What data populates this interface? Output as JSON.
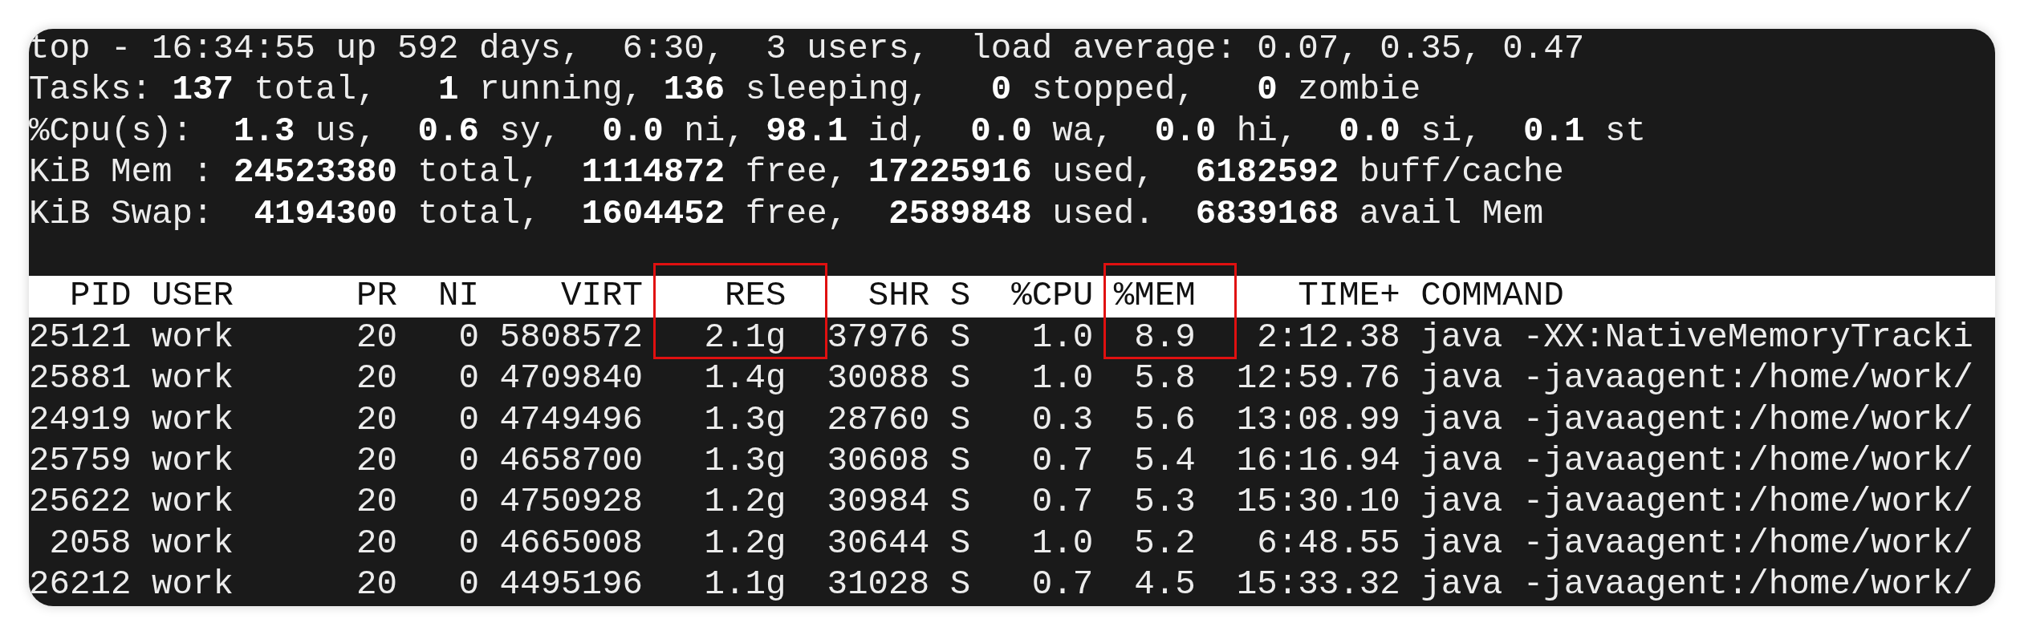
{
  "terminal": {
    "summary_lines": [
      "top - 16:34:55 up 592 days,  6:30,  3 users,  load average: 0.07, 0.35, 0.47",
      "Tasks: **137** total,   **1** running, **136** sleeping,   **0** stopped,   **0** zombie",
      "%Cpu(s):  **1.3** us,  **0.6** sy,  **0.0** ni, **98.1** id,  **0.0** wa,  **0.0** hi,  **0.0** si,  **0.1** st",
      "KiB Mem : **24523380** total,  **1114872** free, **17225916** used,  **6182592** buff/cache",
      "KiB Swap:  **4194300** total,  **1604452** free,  **2589848** used.  **6839168** avail Mem"
    ],
    "columns": [
      {
        "label": "PID",
        "boxed": false
      },
      {
        "label": "USER",
        "boxed": false
      },
      {
        "label": "PR",
        "boxed": false
      },
      {
        "label": "NI",
        "boxed": false
      },
      {
        "label": "VIRT",
        "boxed": false
      },
      {
        "label": "RES",
        "boxed": true
      },
      {
        "label": "SHR",
        "boxed": false
      },
      {
        "label": "S",
        "boxed": false
      },
      {
        "label": "%CPU",
        "boxed": false
      },
      {
        "label": "%MEM",
        "boxed": true
      },
      {
        "label": "TIME+",
        "boxed": false
      },
      {
        "label": "COMMAND",
        "boxed": false
      }
    ],
    "rows": [
      [
        "25121",
        "work",
        "20",
        "0",
        "5808572",
        "2.1g",
        "37976",
        "S",
        "1.0",
        "8.9",
        "2:12.38",
        "java -XX:NativeMemoryTracki"
      ],
      [
        "25881",
        "work",
        "20",
        "0",
        "4709840",
        "1.4g",
        "30088",
        "S",
        "1.0",
        "5.8",
        "12:59.76",
        "java -javaagent:/home/work/"
      ],
      [
        "24919",
        "work",
        "20",
        "0",
        "4749496",
        "1.3g",
        "28760",
        "S",
        "0.3",
        "5.6",
        "13:08.99",
        "java -javaagent:/home/work/"
      ],
      [
        "25759",
        "work",
        "20",
        "0",
        "4658700",
        "1.3g",
        "30608",
        "S",
        "0.7",
        "5.4",
        "16:16.94",
        "java -javaagent:/home/work/"
      ],
      [
        "25622",
        "work",
        "20",
        "0",
        "4750928",
        "1.2g",
        "30984",
        "S",
        "0.7",
        "5.3",
        "15:30.10",
        "java -javaagent:/home/work/"
      ],
      [
        "2058",
        "work",
        "20",
        "0",
        "4665008",
        "1.2g",
        "30644",
        "S",
        "1.0",
        "5.2",
        "6:48.55",
        "java -javaagent:/home/work/"
      ],
      [
        "26212",
        "work",
        "20",
        "0",
        "4495196",
        "1.1g",
        "31028",
        "S",
        "0.7",
        "4.5",
        "15:33.32",
        "java -javaagent:/home/work/"
      ]
    ]
  }
}
